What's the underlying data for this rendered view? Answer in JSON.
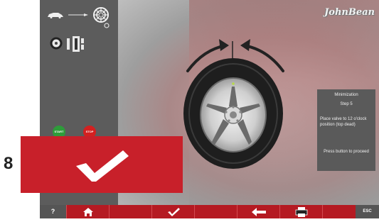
{
  "step_number": "8",
  "logo": "JohnBean",
  "sidebar": {
    "start_label": "START",
    "stop_label": "STOP"
  },
  "info_panel": {
    "title": "Minimization",
    "step": "Step 5",
    "instruction": "Place valve to 12 o'clock position (top dead)",
    "press": "Press button to proceed"
  },
  "bottombar": {
    "help_label": "?",
    "esc_label": "ESC",
    "icons": [
      "home-icon",
      "checkmark-icon",
      "arrow-left-icon",
      "printer-icon"
    ]
  },
  "colors": {
    "accent_red": "#c8202a",
    "sidebar_gray": "#5c5c5c",
    "start_green": "#2e9c3a",
    "stop_red": "#d32020"
  }
}
